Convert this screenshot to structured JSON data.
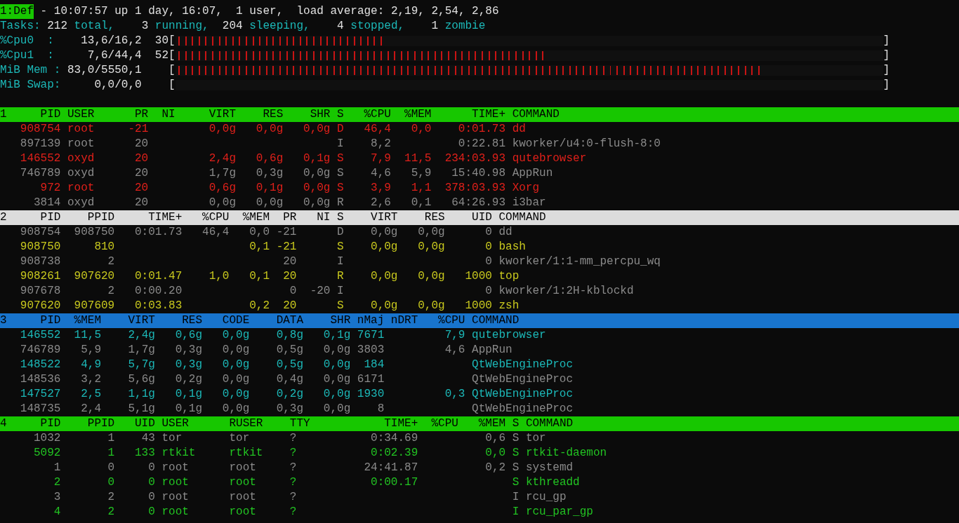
{
  "summary": {
    "window_tag": "1:Def",
    "uptime": "- 10:07:57 up 1 day, 16:07,  1 user,  load average: 2,19, 2,54, 2,86",
    "tasks": {
      "label": "Tasks:",
      "counts": [
        {
          "count": "212",
          "state": "total,"
        },
        {
          "count": "3",
          "state": "running,"
        },
        {
          "count": "204",
          "state": "sleeping,"
        },
        {
          "count": "4",
          "state": "stopped,"
        },
        {
          "count": "1",
          "state": "zombie"
        }
      ]
    },
    "meters": [
      {
        "label": "%Cpu0  :",
        "reading": "13,6/16,2",
        "percent": "30",
        "open": "[",
        "close": "]",
        "level": 0.3
      },
      {
        "label": "%Cpu1  :",
        "reading": "7,6/44,4",
        "percent": "52",
        "open": "[",
        "close": "]",
        "level": 0.52
      },
      {
        "label": "MiB Mem :",
        "reading": "83,0/5550,1",
        "open": "[",
        "close": "]",
        "level": 0.83
      },
      {
        "label": "MiB Swap:",
        "reading": "0,0/0,0",
        "open": "[",
        "close": "]",
        "level": 0
      }
    ]
  },
  "tables": [
    {
      "number": "1",
      "color": "#e0201a",
      "columns": [
        "PID",
        "USER",
        "PR",
        "NI",
        "VIRT",
        "RES",
        "SHR",
        "S",
        "%CPU",
        "%MEM",
        "TIME+",
        "COMMAND"
      ],
      "rows": [
        {
          "dim": false,
          "cells": [
            "908754",
            "root",
            "-21",
            null,
            "0,0g",
            "0,0g",
            "0,0g",
            "D",
            "46,4",
            "0,0",
            "0:01.73",
            "dd"
          ]
        },
        {
          "dim": true,
          "cells": [
            "897139",
            "root",
            "20",
            null,
            null,
            null,
            null,
            "I",
            "8,2",
            null,
            "0:22.81",
            "kworker/u4:0-flush-8:0"
          ]
        },
        {
          "dim": false,
          "cells": [
            "146552",
            "oxyd",
            "20",
            null,
            "2,4g",
            "0,6g",
            "0,1g",
            "S",
            "7,9",
            "11,5",
            "234:03.93",
            "qutebrowser"
          ]
        },
        {
          "dim": true,
          "cells": [
            "746789",
            "oxyd",
            "20",
            null,
            "1,7g",
            "0,3g",
            "0,0g",
            "S",
            "4,6",
            "5,9",
            "15:40.98",
            "AppRun"
          ]
        },
        {
          "dim": false,
          "cells": [
            "972",
            "root",
            "20",
            null,
            "0,6g",
            "0,1g",
            "0,0g",
            "S",
            "3,9",
            "1,1",
            "378:03.93",
            "Xorg"
          ]
        },
        {
          "dim": true,
          "cells": [
            "3814",
            "oxyd",
            "20",
            null,
            "0,0g",
            "0,0g",
            "0,0g",
            "R",
            "2,6",
            "0,1",
            "64:26.93",
            "i3bar"
          ]
        }
      ]
    },
    {
      "number": "2",
      "color": "#c9c91e",
      "columns": [
        "PID",
        "PPID",
        "TIME+",
        "%CPU",
        "%MEM",
        "PR",
        "NI",
        "S",
        "VIRT",
        "RES",
        "UID",
        "COMMAND"
      ],
      "rows": [
        {
          "dim": true,
          "cells": [
            "908754",
            "908750",
            "0:01.73",
            "46,4",
            "0,0",
            "-21",
            null,
            "D",
            "0,0g",
            "0,0g",
            "0",
            "dd"
          ]
        },
        {
          "dim": false,
          "cells": [
            "908750",
            "810",
            null,
            null,
            "0,1",
            "-21",
            null,
            "S",
            "0,0g",
            "0,0g",
            "0",
            "bash"
          ]
        },
        {
          "dim": true,
          "cells": [
            "908738",
            "2",
            null,
            null,
            null,
            "20",
            null,
            "I",
            null,
            null,
            "0",
            "kworker/1:1-mm_percpu_wq"
          ]
        },
        {
          "dim": false,
          "cells": [
            "908261",
            "907620",
            "0:01.47",
            "1,0",
            "0,1",
            "20",
            null,
            "R",
            "0,0g",
            "0,0g",
            "1000",
            "top"
          ]
        },
        {
          "dim": true,
          "cells": [
            "907678",
            "2",
            "0:00.20",
            null,
            null,
            "0",
            "-20",
            "I",
            null,
            null,
            "0",
            "kworker/1:2H-kblockd"
          ]
        },
        {
          "dim": false,
          "cells": [
            "907620",
            "907609",
            "0:03.83",
            null,
            "0,2",
            "20",
            null,
            "S",
            "0,0g",
            "0,0g",
            "1000",
            "zsh"
          ]
        }
      ]
    },
    {
      "number": "3",
      "color": "#1cb8b8",
      "columns": [
        "PID",
        "%MEM",
        "VIRT",
        "RES",
        "CODE",
        "DATA",
        "SHR",
        "nMaj",
        "nDRT",
        "%CPU",
        "COMMAND"
      ],
      "rows": [
        {
          "dim": false,
          "cells": [
            "146552",
            "11,5",
            "2,4g",
            "0,6g",
            "0,0g",
            "0,8g",
            "0,1g",
            "7671",
            null,
            "7,9",
            "qutebrowser"
          ]
        },
        {
          "dim": true,
          "cells": [
            "746789",
            "5,9",
            "1,7g",
            "0,3g",
            "0,0g",
            "0,5g",
            "0,0g",
            "3803",
            null,
            "4,6",
            "AppRun"
          ]
        },
        {
          "dim": false,
          "cells": [
            "148522",
            "4,9",
            "5,7g",
            "0,3g",
            "0,0g",
            "0,5g",
            "0,0g",
            "184",
            null,
            null,
            "QtWebEngineProc"
          ]
        },
        {
          "dim": true,
          "cells": [
            "148536",
            "3,2",
            "5,6g",
            "0,2g",
            "0,0g",
            "0,4g",
            "0,0g",
            "6171",
            null,
            null,
            "QtWebEngineProc"
          ]
        },
        {
          "dim": false,
          "cells": [
            "147527",
            "2,5",
            "1,1g",
            "0,1g",
            "0,0g",
            "0,2g",
            "0,0g",
            "1930",
            null,
            "0,3",
            "QtWebEngineProc"
          ]
        },
        {
          "dim": true,
          "cells": [
            "148735",
            "2,4",
            "5,1g",
            "0,1g",
            "0,0g",
            "0,3g",
            "0,0g",
            "8",
            null,
            null,
            "QtWebEngineProc"
          ]
        }
      ]
    },
    {
      "number": "4",
      "color": "#22c322",
      "columns": [
        "PID",
        "PPID",
        "UID",
        "USER",
        "RUSER",
        "TTY",
        "TIME+",
        "%CPU",
        "%MEM",
        "S",
        "COMMAND"
      ],
      "rows": [
        {
          "dim": true,
          "cells": [
            "1032",
            "1",
            "43",
            "tor",
            "tor",
            "?",
            "0:34.69",
            null,
            "0,6",
            "S",
            "tor"
          ]
        },
        {
          "dim": false,
          "cells": [
            "5092",
            "1",
            "133",
            "rtkit",
            "rtkit",
            "?",
            "0:02.39",
            null,
            "0,0",
            "S",
            "rtkit-daemon"
          ]
        },
        {
          "dim": true,
          "cells": [
            "1",
            "0",
            "0",
            "root",
            "root",
            "?",
            "24:41.87",
            null,
            "0,2",
            "S",
            "systemd"
          ]
        },
        {
          "dim": false,
          "cells": [
            "2",
            "0",
            "0",
            "root",
            "root",
            "?",
            "0:00.17",
            null,
            null,
            "S",
            "kthreadd"
          ]
        },
        {
          "dim": true,
          "cells": [
            "3",
            "2",
            "0",
            "root",
            "root",
            "?",
            null,
            null,
            null,
            "I",
            "rcu_gp"
          ]
        },
        {
          "dim": false,
          "cells": [
            "4",
            "2",
            "0",
            "root",
            "root",
            "?",
            null,
            null,
            null,
            "I",
            "rcu_par_gp"
          ]
        }
      ]
    }
  ]
}
